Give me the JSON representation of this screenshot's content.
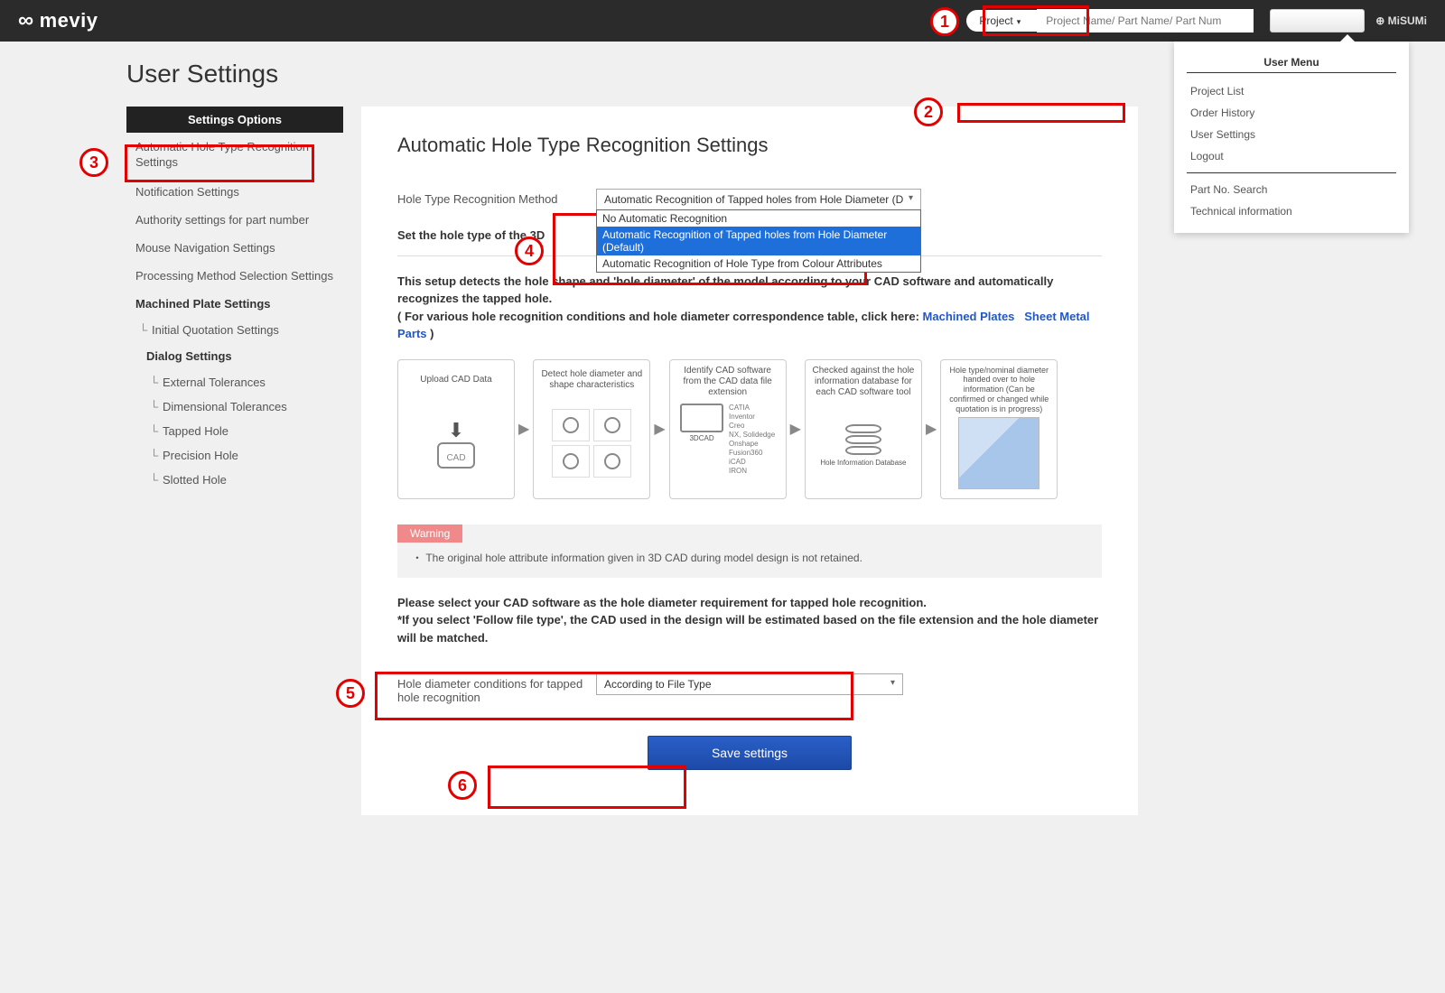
{
  "header": {
    "logo_text": "meviy",
    "search_type": "Project",
    "search_placeholder": "Project Name/ Part Name/ Part Num",
    "misumi": "MiSUMi"
  },
  "user_menu": {
    "title": "User Menu",
    "items_top": [
      "Project List",
      "Order History",
      "User Settings",
      "Logout"
    ],
    "items_bottom": [
      "Part No. Search",
      "Technical information"
    ]
  },
  "page": {
    "title": "User Settings"
  },
  "sidebar": {
    "header": "Settings Options",
    "items": [
      "Automatic Hole Type Recognition Settings",
      "Notification Settings",
      "Authority settings for part number",
      "Mouse Navigation Settings",
      "Processing Method Selection Settings"
    ],
    "section1": "Machined Plate Settings",
    "sec1_items": [
      "Initial Quotation Settings"
    ],
    "section2": "Dialog Settings",
    "sec2_items": [
      "External Tolerances",
      "Dimensional Tolerances",
      "Tapped Hole",
      "Precision Hole",
      "Slotted Hole"
    ]
  },
  "main": {
    "heading": "Automatic Hole Type Recognition Settings",
    "method_label": "Hole Type Recognition Method",
    "method_value": "Automatic Recognition of Tapped holes from Hole Diameter (D",
    "method_options": [
      "No Automatic Recognition",
      "Automatic Recognition of Tapped holes from Hole Diameter (Default)",
      "Automatic Recognition of Hole Type from Colour Attributes"
    ],
    "subtitle": "Set the hole type of the 3D",
    "desc1": "This setup detects the hole shape and 'hole diameter' of the model according to your CAD software and automatically recognizes the tapped hole.",
    "desc2_pre": "( For various hole recognition conditions and hole diameter correspondence table, click here:",
    "link1": "Machined Plates",
    "link2": "Sheet Metal Parts",
    "desc2_post": ")",
    "flow": {
      "b1": "Upload CAD Data",
      "b2": "Detect hole diameter and shape characteristics",
      "b3": "Identify CAD software from the CAD data file extension",
      "b3_label": "3DCAD",
      "b3_list": "CATIA\nInventor\nCreo\nNX, Solidedge\nOnshape\nFusion360\niCAD\nIRON",
      "b4": "Checked against the hole information database for each CAD software tool",
      "b4_label": "Hole Information Database",
      "b5": "Hole type/nominal diameter handed over to hole information (Can be confirmed or changed while quotation is in progress)",
      "cad_label": "CAD"
    },
    "warning_tag": "Warning",
    "warning_text": "・ The original hole attribute information given in 3D CAD during model design is not retained.",
    "desc3": "Please select your CAD software as the hole diameter requirement for tapped hole recognition.",
    "desc4": "*If you select 'Follow file type', the CAD used in the design will be estimated based on the file extension and the hole diameter will be matched.",
    "cond_label": "Hole diameter conditions for tapped hole recognition",
    "cond_value": "According to File Type",
    "save_label": "Save settings"
  },
  "callouts": {
    "n1": "1",
    "n2": "2",
    "n3": "3",
    "n4": "4",
    "n5": "5",
    "n6": "6"
  }
}
